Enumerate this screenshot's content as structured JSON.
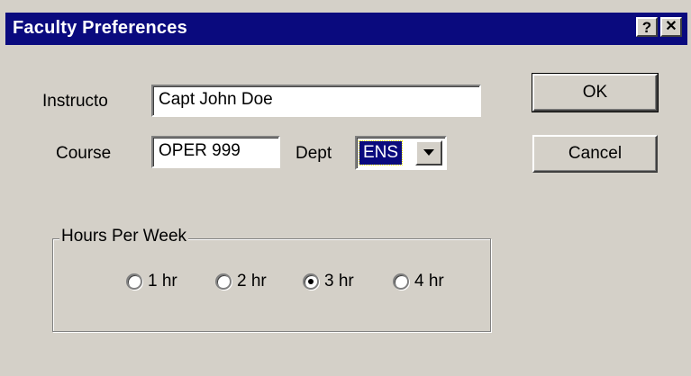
{
  "window": {
    "title": "Faculty Preferences",
    "help_button": "?",
    "close_button": "✕"
  },
  "form": {
    "instructor_label": "Instructo",
    "instructor_value": "Capt John Doe",
    "course_label": "Course",
    "course_value": "OPER 999",
    "dept_label": "Dept",
    "dept_value": "ENS"
  },
  "buttons": {
    "ok": "OK",
    "cancel": "Cancel"
  },
  "hours_group": {
    "title": "Hours Per Week",
    "options": [
      {
        "label": "1 hr",
        "selected": false
      },
      {
        "label": "2 hr",
        "selected": false
      },
      {
        "label": "3 hr",
        "selected": true
      },
      {
        "label": "4 hr",
        "selected": false
      }
    ]
  },
  "colors": {
    "titlebar": "#0a0a7e",
    "dialog_bg": "#d4d0c8"
  }
}
